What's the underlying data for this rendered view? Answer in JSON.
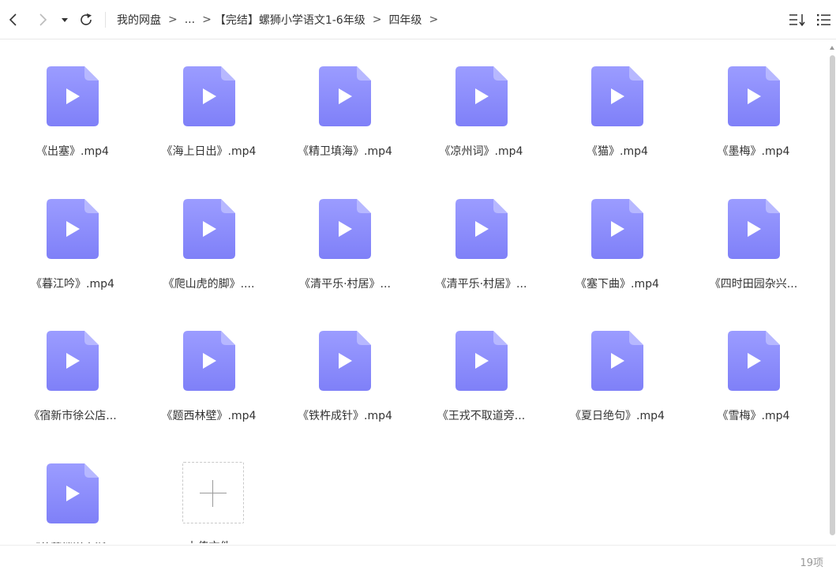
{
  "toolbar": {
    "breadcrumb": {
      "root": "我的网盘",
      "ellipsis": "...",
      "folder": "【完结】螺狮小学语文1-6年级",
      "current": "四年级",
      "separator": ">"
    },
    "icons": [
      "back-arrow",
      "forward-arrow",
      "dropdown-caret",
      "refresh",
      "sort-view",
      "list-view"
    ]
  },
  "files": [
    {
      "name": "《出塞》.mp4"
    },
    {
      "name": "《海上日出》.mp4"
    },
    {
      "name": "《精卫填海》.mp4"
    },
    {
      "name": "《凉州词》.mp4"
    },
    {
      "name": "《猫》.mp4"
    },
    {
      "name": "《墨梅》.mp4"
    },
    {
      "name": "《暮江吟》.mp4"
    },
    {
      "name": "《爬山虎的脚》...."
    },
    {
      "name": "《清平乐·村居》..."
    },
    {
      "name": "《清平乐·村居》..."
    },
    {
      "name": "《塞下曲》.mp4"
    },
    {
      "name": "《四时田园杂兴..."
    },
    {
      "name": "《宿新市徐公店..."
    },
    {
      "name": "《题西林壁》.mp4"
    },
    {
      "name": "《铁杵成针》.mp4"
    },
    {
      "name": "《王戎不取道旁..."
    },
    {
      "name": "《夏日绝句》.mp4"
    },
    {
      "name": "《雪梅》.mp4"
    },
    {
      "name": "《芙蓉楼送辛渐..."
    }
  ],
  "upload": {
    "label": "上传文件"
  },
  "status": {
    "count": "19项"
  },
  "colors": {
    "file_icon_top": "#9b9cff",
    "file_icon_bottom": "#7f80f8",
    "play": "#ffffff"
  }
}
